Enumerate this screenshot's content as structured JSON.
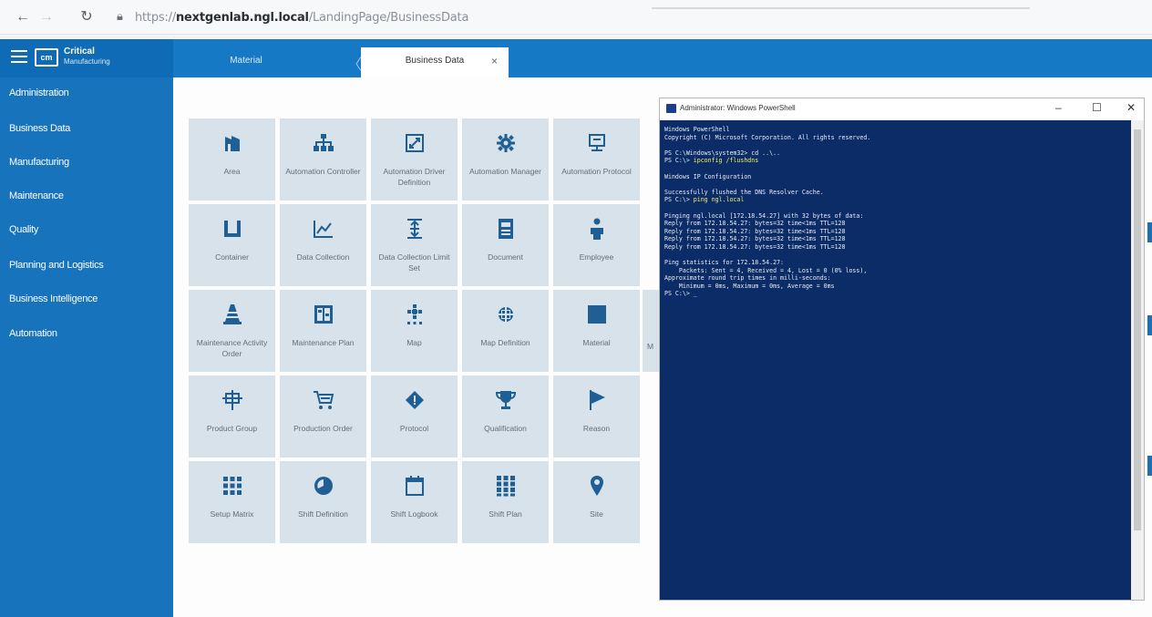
{
  "browser": {
    "url_prefix": "https://",
    "url_host": "nextgenlab.ngl.local",
    "url_path": "/LandingPage/BusinessData"
  },
  "brand": {
    "logo": "cm",
    "name_line1": "Critical",
    "name_line2": "Manufacturing"
  },
  "tabs": [
    {
      "label": "Material"
    },
    {
      "label": "Business Data",
      "close": "×"
    }
  ],
  "sidebar": {
    "items": [
      {
        "label": "Administration"
      },
      {
        "label": "Business Data"
      },
      {
        "label": "Manufacturing"
      },
      {
        "label": "Maintenance"
      },
      {
        "label": "Quality"
      },
      {
        "label": "Planning and Logistics"
      },
      {
        "label": "Business Intelligence"
      },
      {
        "label": "Automation"
      }
    ]
  },
  "tiles": [
    {
      "label": "Area",
      "icon": "area-icon"
    },
    {
      "label": "Automation Controller",
      "icon": "hierarchy-icon"
    },
    {
      "label": "Automation Driver Definition",
      "icon": "driver-icon"
    },
    {
      "label": "Automation Manager",
      "icon": "gear-icon"
    },
    {
      "label": "Automation Protocol",
      "icon": "monitor-icon"
    },
    {
      "label": "Container",
      "icon": "container-icon"
    },
    {
      "label": "Data Collection",
      "icon": "chart-icon"
    },
    {
      "label": "Data Collection Limit Set",
      "icon": "limit-icon"
    },
    {
      "label": "Document",
      "icon": "document-icon"
    },
    {
      "label": "Employee",
      "icon": "person-icon"
    },
    {
      "label": "Maintenance Activity Order",
      "icon": "cone-icon"
    },
    {
      "label": "Maintenance Plan",
      "icon": "plan-icon"
    },
    {
      "label": "Map",
      "icon": "map-icon"
    },
    {
      "label": "Map Definition",
      "icon": "map-definition-icon"
    },
    {
      "label": "Material",
      "icon": "square-icon"
    },
    {
      "label": "Product Group",
      "icon": "product-group-icon"
    },
    {
      "label": "Production Order",
      "icon": "cart-icon"
    },
    {
      "label": "Protocol",
      "icon": "diamond-icon"
    },
    {
      "label": "Qualification",
      "icon": "trophy-icon"
    },
    {
      "label": "Reason",
      "icon": "flag-icon"
    },
    {
      "label": "Setup Matrix",
      "icon": "grid-icon"
    },
    {
      "label": "Shift Definition",
      "icon": "clock-icon"
    },
    {
      "label": "Shift Logbook",
      "icon": "calendar-icon"
    },
    {
      "label": "Shift Plan",
      "icon": "grid-dots-icon"
    },
    {
      "label": "Site",
      "icon": "pin-icon"
    }
  ],
  "partial_tile_letter": "M",
  "powershell": {
    "title": "Administrator: Windows PowerShell",
    "lines": [
      {
        "t": "Windows PowerShell"
      },
      {
        "t": "Copyright (C) Microsoft Corporation. All rights reserved."
      },
      {
        "t": ""
      },
      {
        "t": "PS C:\\Windows\\system32> cd ..\\.."
      },
      {
        "t": "PS C:\\> ",
        "c": "ipconfig /flushdns"
      },
      {
        "t": ""
      },
      {
        "t": "Windows IP Configuration"
      },
      {
        "t": ""
      },
      {
        "t": "Successfully flushed the DNS Resolver Cache."
      },
      {
        "t": "PS C:\\> ",
        "c": "ping ngl.local"
      },
      {
        "t": ""
      },
      {
        "t": "Pinging ngl.local [172.18.54.27] with 32 bytes of data:"
      },
      {
        "t": "Reply from 172.18.54.27: bytes=32 time<1ms TTL=128"
      },
      {
        "t": "Reply from 172.18.54.27: bytes=32 time<1ms TTL=128"
      },
      {
        "t": "Reply from 172.18.54.27: bytes=32 time<1ms TTL=128"
      },
      {
        "t": "Reply from 172.18.54.27: bytes=32 time<1ms TTL=128"
      },
      {
        "t": ""
      },
      {
        "t": "Ping statistics for 172.18.54.27:"
      },
      {
        "t": "    Packets: Sent = 4, Received = 4, Lost = 0 (0% loss),"
      },
      {
        "t": "Approximate round trip times in milli-seconds:"
      },
      {
        "t": "    Minimum = 0ms, Maximum = 0ms, Average = 0ms"
      },
      {
        "t": "PS C:\\> _"
      }
    ]
  },
  "colors": {
    "sidebar": "#1873bd",
    "header": "#1679c6",
    "tile": "#d7e2ea",
    "tile_icon": "#1f5f94",
    "powershell_bg": "#0b2c66"
  }
}
